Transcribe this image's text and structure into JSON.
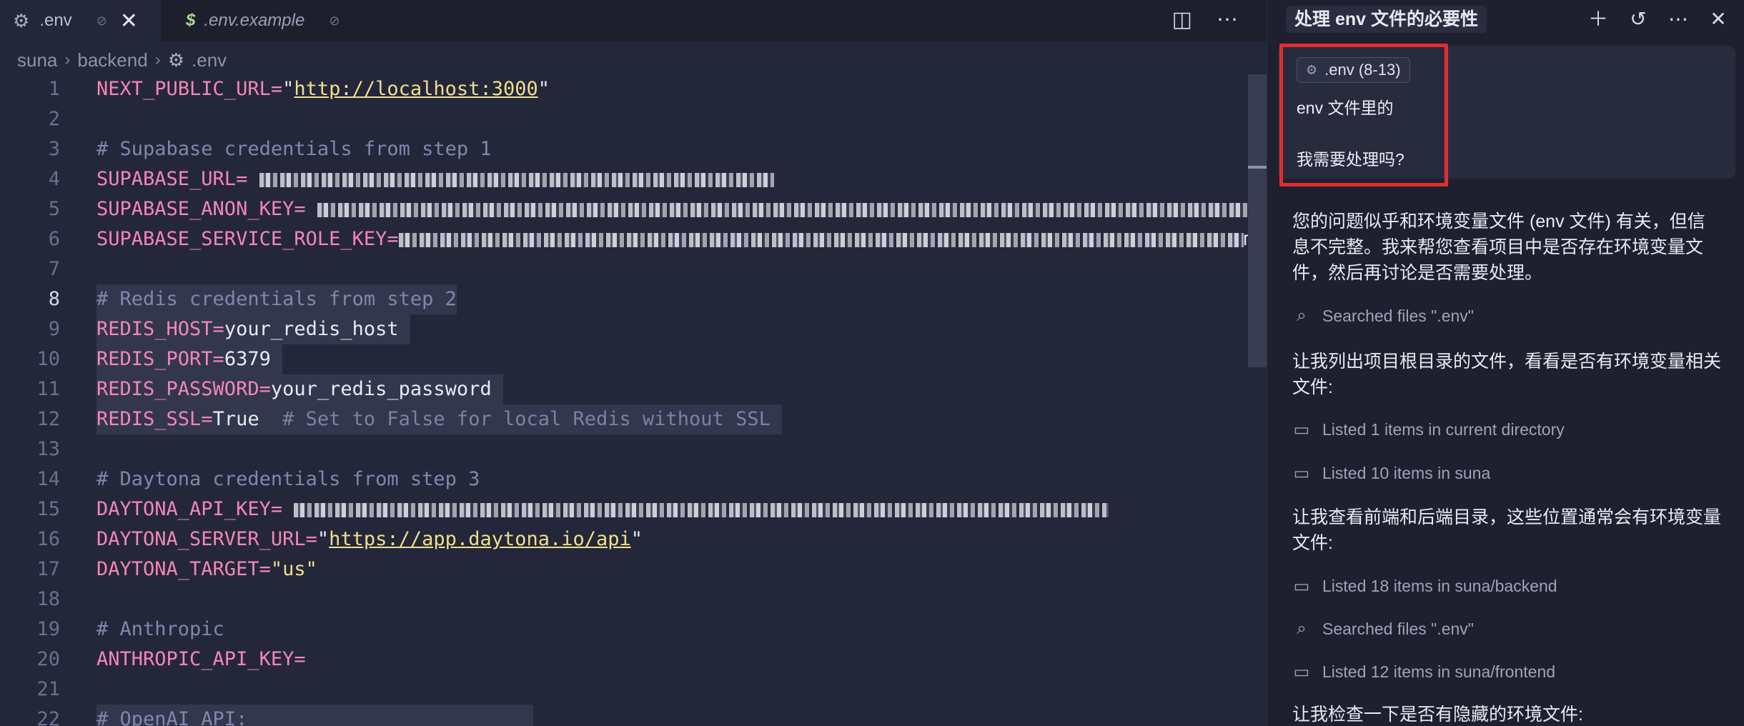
{
  "tabs": [
    {
      "label": ".env",
      "icon": "gear-icon",
      "pin": "⊘",
      "close": "✕"
    },
    {
      "label": ".env.example",
      "icon": "dollar-icon",
      "pin": "⊘"
    }
  ],
  "breadcrumb": {
    "items": [
      "suna",
      "backend",
      ".env"
    ]
  },
  "code": {
    "l1_key": "NEXT_PUBLIC_URL=",
    "l1_q1": "\"",
    "l1_url": "http://localhost:3000",
    "l1_q2": "\"",
    "l3": "# Supabase credentials from step 1",
    "l4_key": "SUPABASE_URL=",
    "l5_key": "SUPABASE_ANON_KEY=",
    "l6_key": "SUPABASE_SERVICE_ROLE_KEY=",
    "l6_tail": "m",
    "l8": "# Redis credentials from step 2",
    "l9_key": "REDIS_HOST=",
    "l9_val": "your_redis_host",
    "l10_key": "REDIS_PORT=",
    "l10_val": "6379",
    "l11_key": "REDIS_PASSWORD=",
    "l11_val": "your_redis_password",
    "l12_key": "REDIS_SSL=",
    "l12_val": "True",
    "l12_cmt": "  # Set to False for local Redis without SSL",
    "l14": "# Daytona credentials from step 3",
    "l15_key": "DAYTONA_API_KEY=",
    "l16_key": "DAYTONA_SERVER_URL=",
    "l16_q1": "\"",
    "l16_url": "https://app.daytona.io/api",
    "l16_q2": "\"",
    "l17_key": "DAYTONA_TARGET=",
    "l17_val": "\"us\"",
    "l19": "# Anthropic",
    "l20_key": "ANTHROPIC_API_KEY=",
    "l22": "# OpenAI API:"
  },
  "line_numbers": [
    "1",
    "2",
    "3",
    "4",
    "5",
    "6",
    "7",
    "8",
    "9",
    "10",
    "11",
    "12",
    "13",
    "14",
    "15",
    "16",
    "17",
    "18",
    "19",
    "20",
    "21",
    "22"
  ],
  "chat": {
    "title": "处理 env 文件的必要性",
    "context_chip": ".env (8-13)",
    "user_line1": "env 文件里的",
    "user_line2": "我需要处理吗?",
    "msg1": "您的问题似乎和环境变量文件 (env 文件) 有关，但信息不完整。我来帮您查看项目中是否存在环境变量文件，然后再讨论是否需要处理。",
    "tool1": "Searched files \".env\"",
    "msg2": "让我列出项目根目录的文件，看看是否有环境变量相关文件:",
    "tool2": "Listed 1 items in current directory",
    "tool3": "Listed 10 items in suna",
    "msg3": "让我查看前端和后端目录，这些位置通常会有环境变量文件:",
    "tool4": "Listed 18 items in suna/backend",
    "tool5": "Searched files \".env\"",
    "tool6": "Listed 12 items in suna/frontend",
    "msg4": "让我检查一下是否有隐藏的环境文件:"
  },
  "colors": {
    "highlight": "#e02e2e",
    "key": "#f386b8",
    "string": "#f0df8c",
    "comment": "#7f88ac"
  }
}
